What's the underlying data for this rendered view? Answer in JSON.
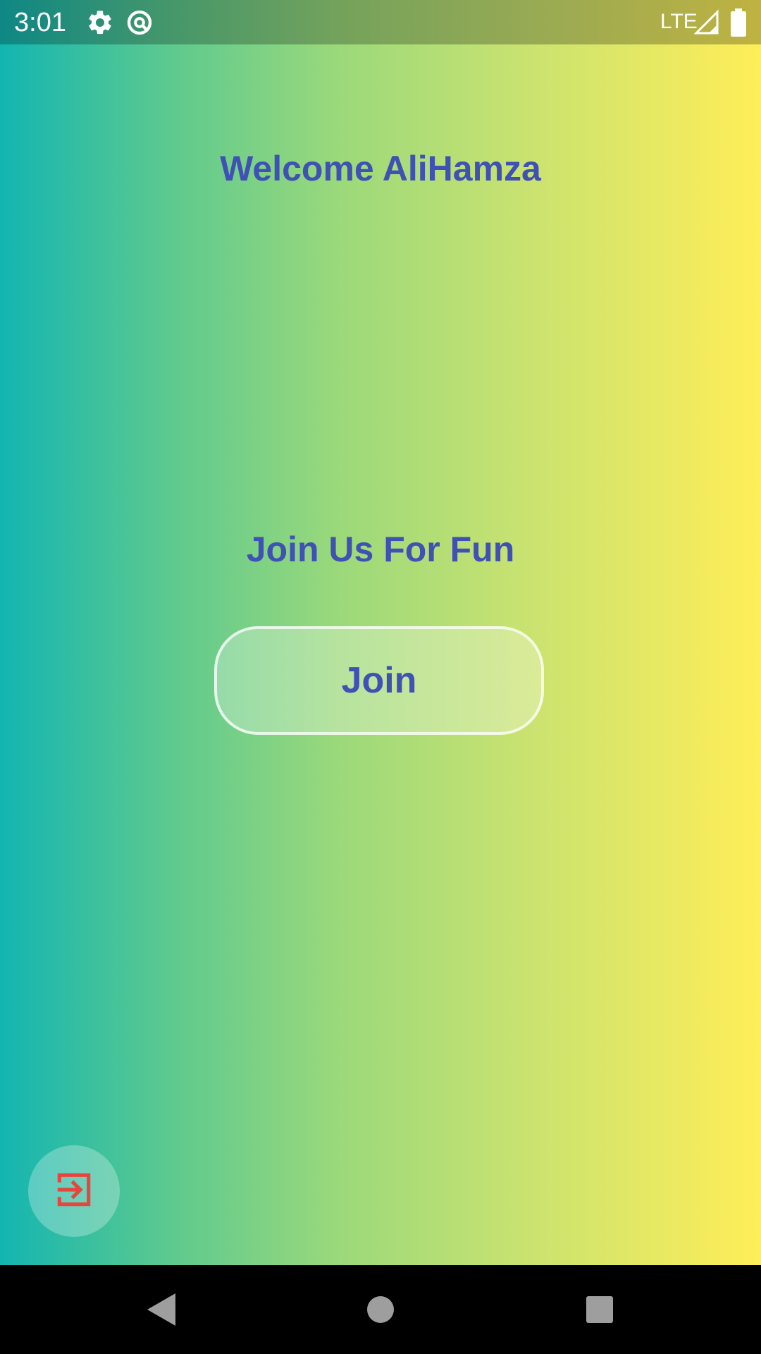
{
  "status_bar": {
    "time": "3:01",
    "network": "LTE",
    "icons": [
      "gear-icon",
      "data-saver-icon",
      "signal-icon",
      "battery-icon"
    ]
  },
  "main": {
    "welcome_text": "Welcome AliHamza",
    "tagline": "Join Us For Fun",
    "join_button_label": "Join"
  },
  "fab": {
    "icon": "exit-to-app-icon",
    "icon_color": "#e8453c"
  },
  "nav_bar": {
    "icons": [
      "back-icon",
      "home-icon",
      "recents-icon"
    ]
  },
  "colors": {
    "text_accent": "#3f51b5",
    "gradient_start": "#13b5b1",
    "gradient_end": "#ffee58"
  }
}
